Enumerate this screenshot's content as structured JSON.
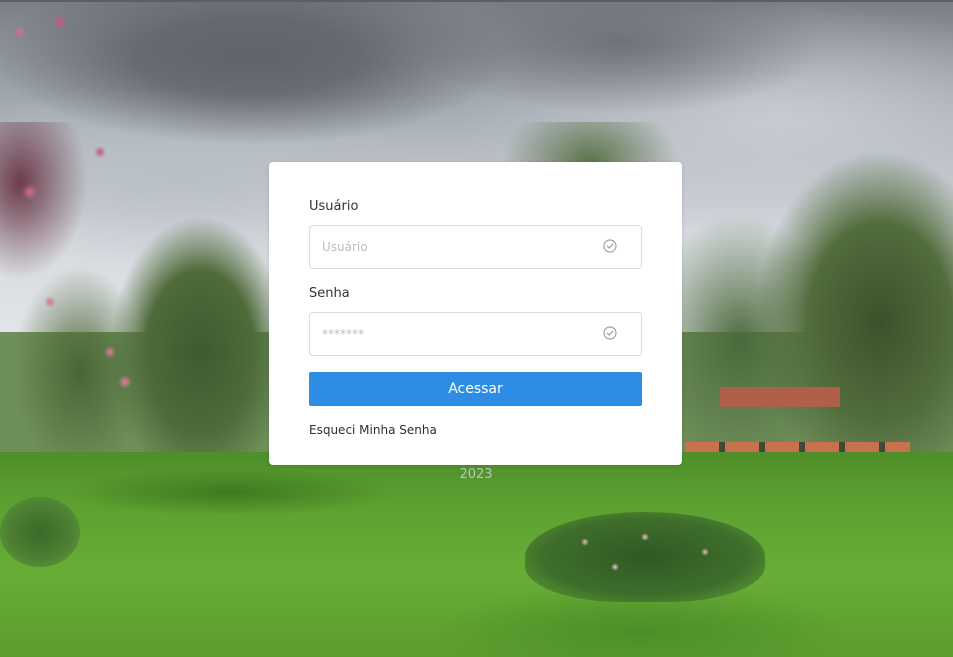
{
  "form": {
    "username_label": "Usuário",
    "username_placeholder": "Usuário",
    "username_value": "",
    "password_label": "Senha",
    "password_placeholder": "*******",
    "password_value": "",
    "submit_label": "Acessar",
    "forgot_link": "Esqueci Minha Senha"
  },
  "footer": {
    "year": "2023"
  },
  "icons": {
    "username_status": "check-circle-icon",
    "password_status": "check-circle-icon"
  },
  "colors": {
    "primary": "#2d8ce3",
    "card_bg": "#ffffff",
    "input_border": "#d9dde1",
    "placeholder": "#b9bec3",
    "icon": "#9aa0a6"
  }
}
